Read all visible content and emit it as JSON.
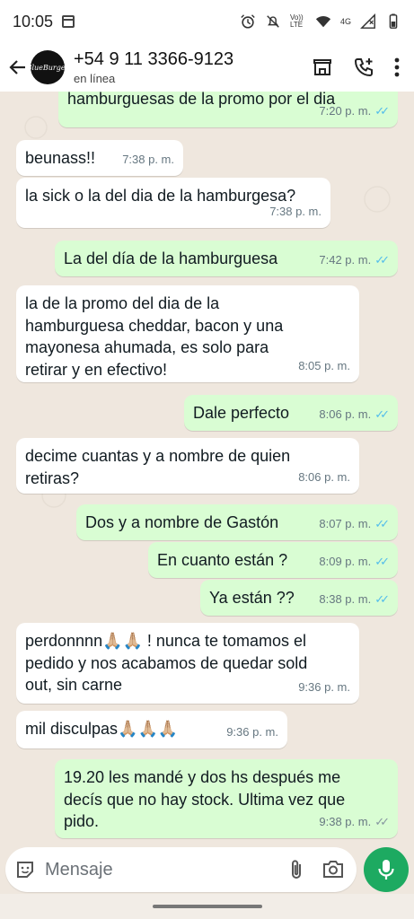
{
  "status_bar": {
    "time": "10:05",
    "network": "4G",
    "volte": "Vo)) LTE"
  },
  "header": {
    "contact_name": "+54 9 11 3366-9123",
    "status": "en línea",
    "avatar_text": "BlueBurger"
  },
  "messages": [
    {
      "dir": "out",
      "text": "hamburguesas de la promo por el dia",
      "time": "7:20 p. m.",
      "read": true
    },
    {
      "dir": "in",
      "text": "beunass!!",
      "time": "7:38 p. m."
    },
    {
      "dir": "in",
      "text": "la sick o la del dia de la hamburgesa?",
      "time": "7:38 p. m."
    },
    {
      "dir": "out",
      "text": "La del día de la hamburguesa",
      "time": "7:42 p. m.",
      "read": true
    },
    {
      "dir": "in",
      "text": "la de la promo del dia de la hamburguesa cheddar, bacon y una mayonesa ahumada, es solo para retirar y en efectivo!",
      "time": "8:05 p. m."
    },
    {
      "dir": "out",
      "text": "Dale perfecto",
      "time": "8:06 p. m.",
      "read": true
    },
    {
      "dir": "in",
      "text": "decime cuantas y a nombre de quien retiras?",
      "time": "8:06 p. m."
    },
    {
      "dir": "out",
      "text": "Dos y a nombre de Gastón",
      "time": "8:07 p. m.",
      "read": true
    },
    {
      "dir": "out",
      "text": "En cuanto están ?",
      "time": "8:09 p. m.",
      "read": true
    },
    {
      "dir": "out",
      "text": "Ya están ??",
      "time": "8:38 p. m.",
      "read": true
    },
    {
      "dir": "in",
      "text": "perdonnnn🙏🏼🙏🏼 ! nunca te tomamos el pedido y nos acabamos de quedar sold out, sin carne",
      "time": "9:36 p. m."
    },
    {
      "dir": "in",
      "text": "mil disculpas🙏🏼🙏🏼🙏🏼",
      "time": "9:36 p. m."
    },
    {
      "dir": "out",
      "text": "19.20 les mandé y dos hs después me decís que no hay stock. Ultima vez que pido.",
      "time": "9:38 p. m.",
      "read": false
    }
  ],
  "composer": {
    "placeholder": "Mensaje"
  },
  "colors": {
    "outgoing_bubble": "#d9fdd3",
    "incoming_bubble": "#ffffff",
    "chat_background": "#efe7de",
    "read_tick": "#53bdeb",
    "mic_button": "#1daa61"
  }
}
